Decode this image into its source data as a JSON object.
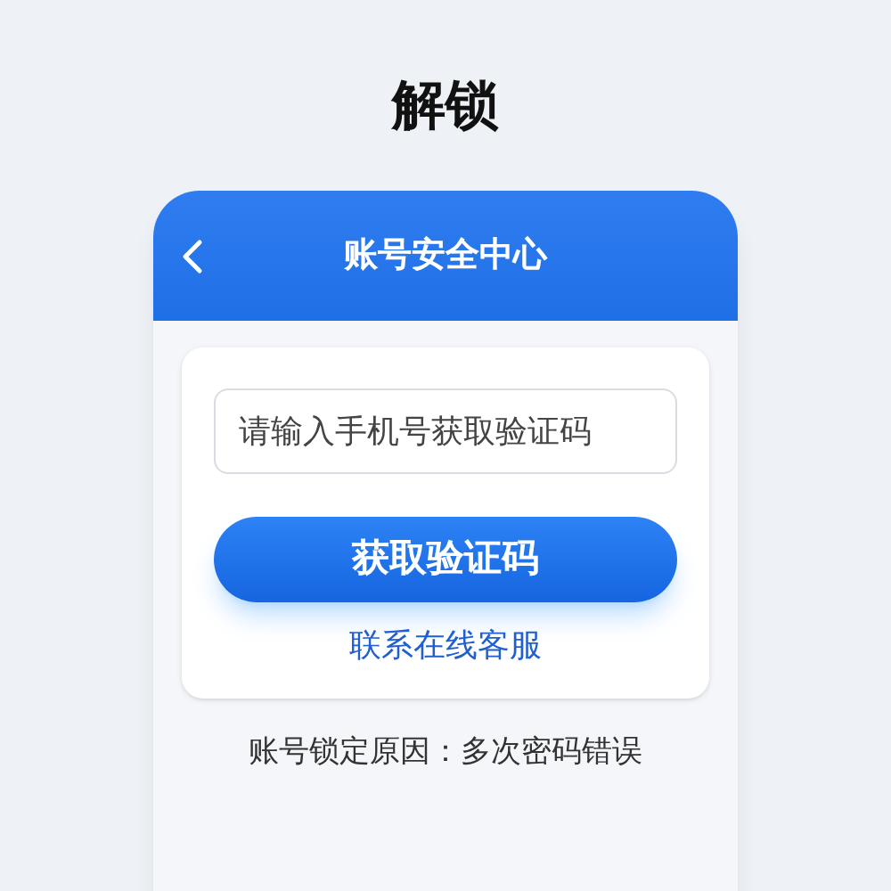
{
  "page_title": "解锁",
  "header": {
    "title": "账号安全中心"
  },
  "phone_field": {
    "placeholder": "请输入手机号获取验证码"
  },
  "primary_button": "获取验证码",
  "support_link": "联系在线客服",
  "lock_reason": "账号锁定原因：多次密码错误"
}
